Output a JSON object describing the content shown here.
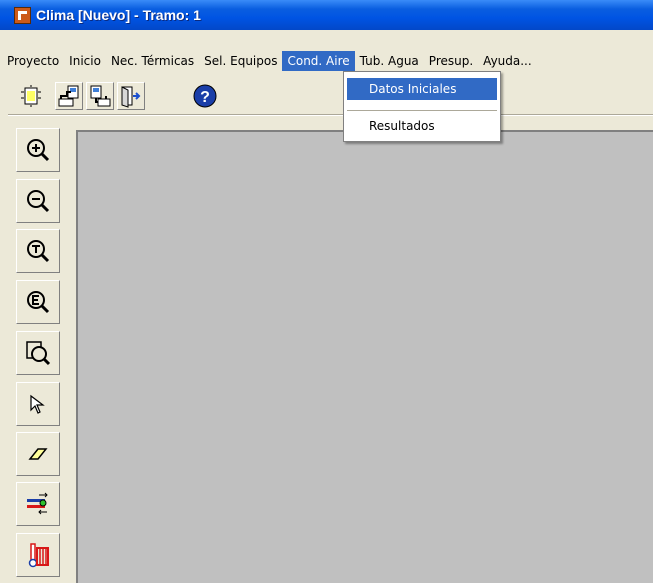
{
  "window": {
    "title": "Clima [Nuevo] - Tramo: 1",
    "title_color": "#ffffff",
    "titlebar_color": "#0054e3",
    "app_icon": "app-logo-icon"
  },
  "menubar": {
    "items": [
      {
        "label": "Proyecto"
      },
      {
        "label": "Inicio"
      },
      {
        "label": "Nec. Térmicas"
      },
      {
        "label": "Sel. Equipos"
      },
      {
        "label": "Cond. Aire",
        "active": true
      },
      {
        "label": "Tub. Agua"
      },
      {
        "label": "Presup."
      },
      {
        "label": "Ayuda..."
      }
    ],
    "highlight_color": "#316ac5"
  },
  "dropdown": {
    "parent": "Cond. Aire",
    "items": [
      {
        "label": "Datos Iniciales",
        "selected": true
      },
      {
        "label": "Resultados"
      }
    ]
  },
  "toolbar_top": {
    "buttons": [
      {
        "icon": "new-document-icon"
      },
      {
        "icon": "open-file-icon"
      },
      {
        "icon": "save-file-icon"
      },
      {
        "icon": "exit-door-icon"
      },
      {
        "icon": "help-icon"
      }
    ]
  },
  "toolbar_left": {
    "buttons": [
      {
        "icon": "zoom-in-icon"
      },
      {
        "icon": "zoom-out-icon"
      },
      {
        "icon": "zoom-total-icon"
      },
      {
        "icon": "zoom-extents-icon"
      },
      {
        "icon": "zoom-window-icon"
      },
      {
        "icon": "select-pointer-icon"
      },
      {
        "icon": "eraser-icon"
      },
      {
        "icon": "pipe-node-icon"
      },
      {
        "icon": "thermometer-radiator-icon"
      }
    ]
  },
  "canvas": {
    "background": "#c0c0c0"
  }
}
